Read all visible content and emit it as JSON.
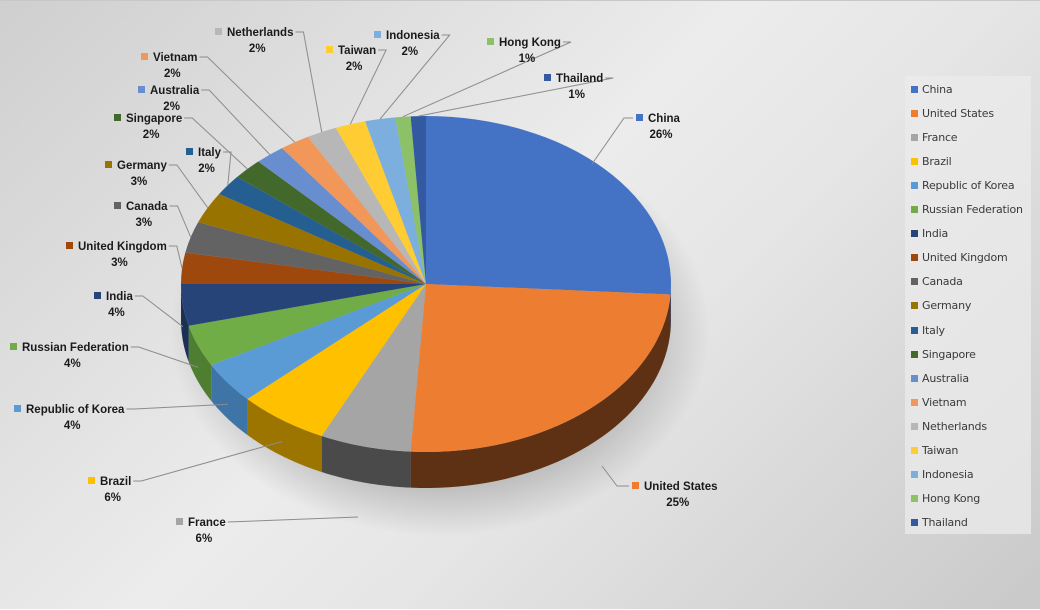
{
  "chart_data": {
    "type": "pie",
    "style": "3d",
    "title": "",
    "start_angle": "12 o'clock",
    "direction": "clockwise",
    "legend_position": "right",
    "slices": [
      {
        "label": "China",
        "value": 26,
        "pct_label": "26%",
        "color": "#4472C4",
        "side_color": "#2F5597"
      },
      {
        "label": "United States",
        "value": 25,
        "pct_label": "25%",
        "color": "#ED7D31",
        "side_color": "#5E3014"
      },
      {
        "label": "France",
        "value": 6,
        "pct_label": "6%",
        "color": "#A5A5A5",
        "side_color": "#4A4A4A"
      },
      {
        "label": "Brazil",
        "value": 6,
        "pct_label": "6%",
        "color": "#FFC000",
        "side_color": "#9C7400"
      },
      {
        "label": "Republic of Korea",
        "value": 4,
        "pct_label": "4%",
        "color": "#5B9BD5",
        "side_color": "#3F74A6"
      },
      {
        "label": "Russian Federation",
        "value": 4,
        "pct_label": "4%",
        "color": "#70AD47",
        "side_color": "#4E7E30"
      },
      {
        "label": "India",
        "value": 4,
        "pct_label": "4%",
        "color": "#264478",
        "side_color": "#1A3055"
      },
      {
        "label": "United Kingdom",
        "value": 3,
        "pct_label": "3%",
        "color": "#9E480E",
        "side_color": "#6E320A"
      },
      {
        "label": "Canada",
        "value": 3,
        "pct_label": "3%",
        "color": "#636363",
        "side_color": "#444444"
      },
      {
        "label": "Germany",
        "value": 3,
        "pct_label": "3%",
        "color": "#997300",
        "side_color": "#6B5000"
      },
      {
        "label": "Italy",
        "value": 2,
        "pct_label": "2%",
        "color": "#255E91",
        "side_color": "#1A4266"
      },
      {
        "label": "Singapore",
        "value": 2,
        "pct_label": "2%",
        "color": "#43682B",
        "side_color": "#2F491E"
      },
      {
        "label": "Australia",
        "value": 2,
        "pct_label": "2%",
        "color": "#698ED0",
        "side_color": "#4A6392"
      },
      {
        "label": "Vietnam",
        "value": 2,
        "pct_label": "2%",
        "color": "#F1975A",
        "side_color": "#A9693F"
      },
      {
        "label": "Netherlands",
        "value": 2,
        "pct_label": "2%",
        "color": "#B7B7B7",
        "side_color": "#808080"
      },
      {
        "label": "Taiwan",
        "value": 2,
        "pct_label": "2%",
        "color": "#FFCD33",
        "side_color": "#B39024"
      },
      {
        "label": "Indonesia",
        "value": 2,
        "pct_label": "2%",
        "color": "#7CAFDD",
        "side_color": "#577A9B"
      },
      {
        "label": "Hong Kong",
        "value": 1,
        "pct_label": "1%",
        "color": "#8CC168",
        "side_color": "#628749"
      },
      {
        "label": "Thailand",
        "value": 1,
        "pct_label": "1%",
        "color": "#335AA1",
        "side_color": "#243F71"
      }
    ]
  }
}
